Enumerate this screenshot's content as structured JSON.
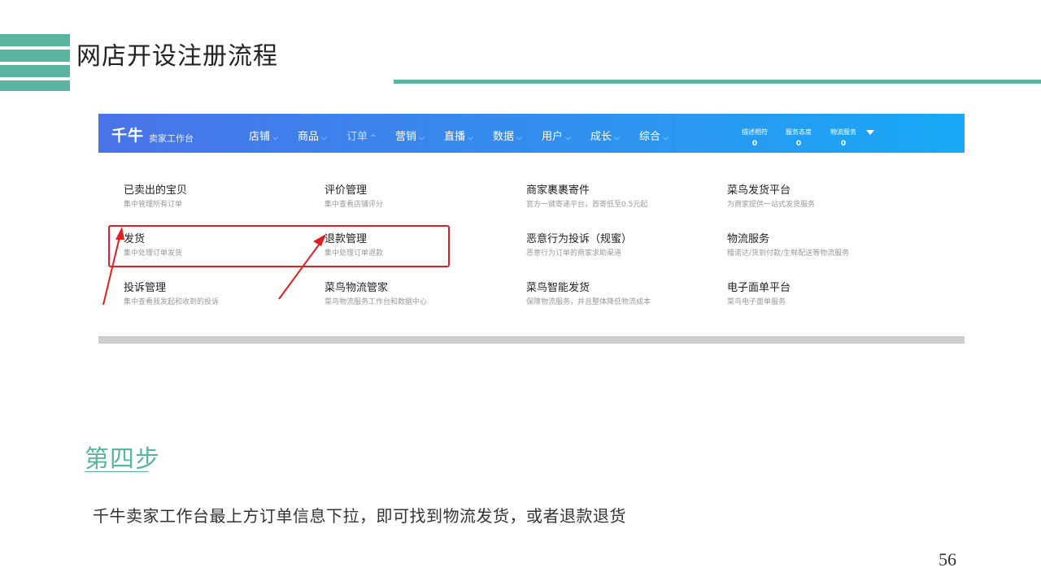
{
  "slide": {
    "title": "网店开设注册流程",
    "accent_color": "#5bb4a0",
    "step_title": "第四步",
    "step_desc": "千牛卖家工作台最上方订单信息下拉，即可找到物流发货，或者退款退货",
    "page_number": "56"
  },
  "screenshot": {
    "brand": "千牛",
    "brand_sub": "卖家工作台",
    "nav_items": [
      {
        "label": "店铺",
        "caret": "chevron-down-icon"
      },
      {
        "label": "商品",
        "caret": "chevron-down-icon"
      },
      {
        "label": "订单",
        "caret": "chevron-up-icon",
        "active": true
      },
      {
        "label": "营销",
        "caret": "chevron-down-icon"
      },
      {
        "label": "直播",
        "caret": "chevron-down-icon"
      },
      {
        "label": "数据",
        "caret": "chevron-down-icon"
      },
      {
        "label": "用户",
        "caret": "chevron-down-icon"
      },
      {
        "label": "成长",
        "caret": "chevron-down-icon"
      },
      {
        "label": "综合",
        "caret": "chevron-down-icon"
      }
    ],
    "stats": [
      {
        "label": "描述相符",
        "value": "0"
      },
      {
        "label": "服务态度",
        "value": "0"
      },
      {
        "label": "物流服务",
        "value": "0"
      }
    ],
    "menu": [
      {
        "title": "已卖出的宝贝",
        "desc": "集中管理所有订单"
      },
      {
        "title": "评价管理",
        "desc": "集中查看店铺评分"
      },
      {
        "title": "商家裹裹寄件",
        "desc": "官方一键寄递平台，首寄低至0.5元起"
      },
      {
        "title": "菜鸟发货平台",
        "desc": "为商家提供一站式发货服务"
      },
      {
        "title": "发货",
        "desc": "集中处理订单发货"
      },
      {
        "title": "退款管理",
        "desc": "集中处理订单退款"
      },
      {
        "title": "恶意行为投诉（规蜜）",
        "desc": "恶意行为订单的商家求助渠道"
      },
      {
        "title": "物流服务",
        "desc": "稽诺达/货到付款/生鲜配送等物流服务"
      },
      {
        "title": "投诉管理",
        "desc": "集中查看我发起和收到的投诉"
      },
      {
        "title": "菜鸟物流管家",
        "desc": "菜鸟物流服务工作台和数据中心"
      },
      {
        "title": "菜鸟智能发货",
        "desc": "保障物流服务，并且整体降低物流成本"
      },
      {
        "title": "电子面单平台",
        "desc": "菜鸟电子面单服务"
      }
    ],
    "highlight_color": "#e02020"
  }
}
